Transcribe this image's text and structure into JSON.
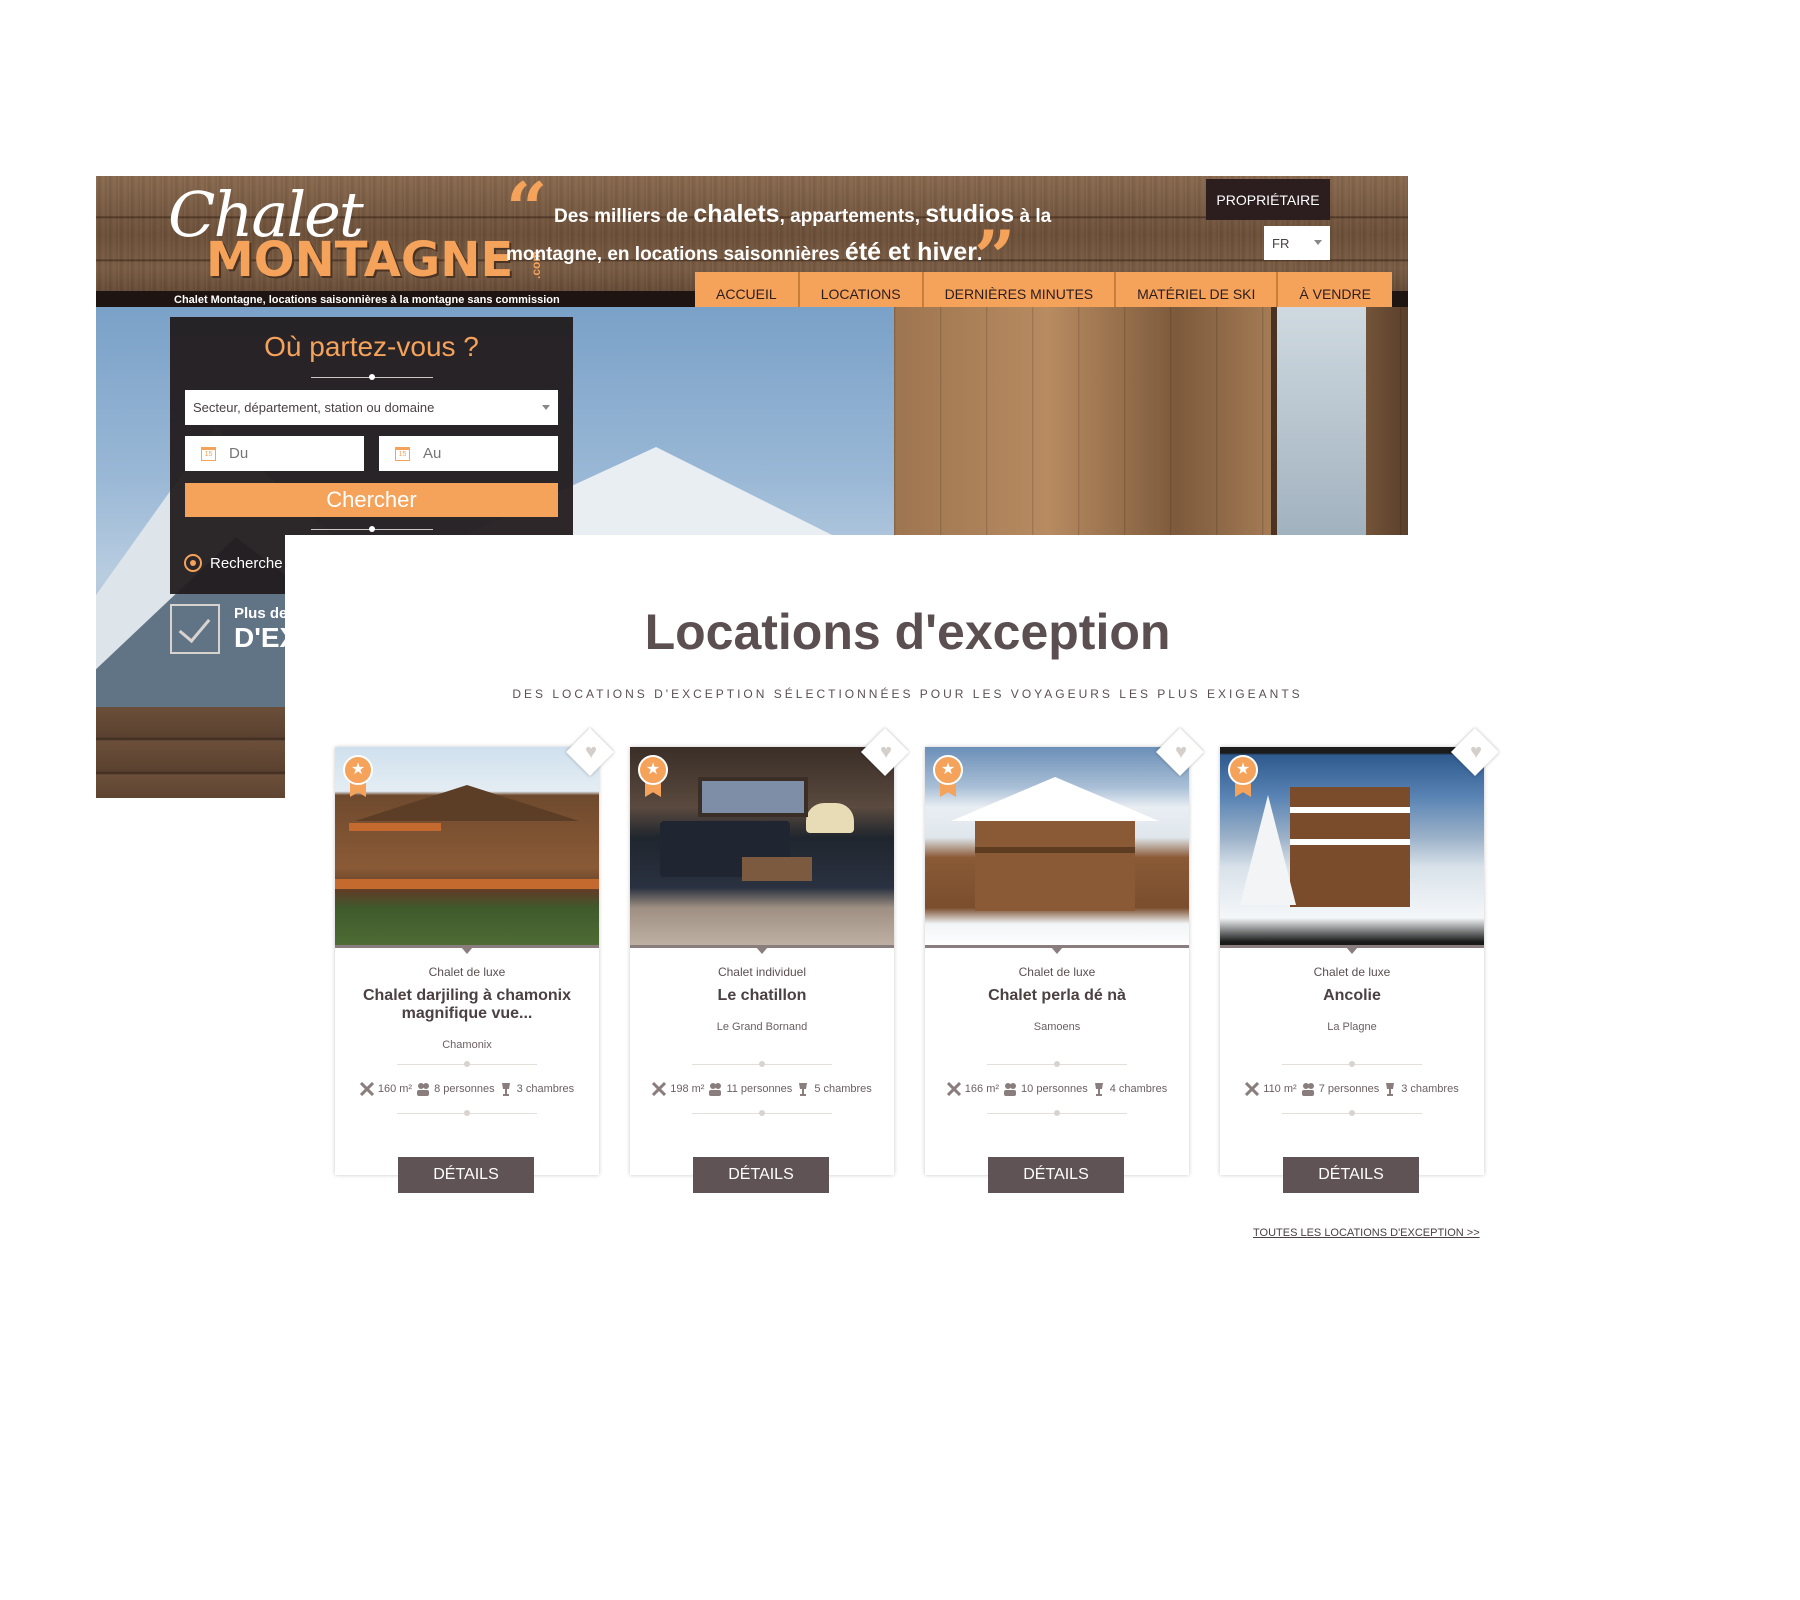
{
  "header": {
    "logo_script": "Chalet",
    "logo_main": "MONTAGNE",
    "logo_suffix": ".com",
    "tagline": "Chalet Montagne, locations saisonnières à la montagne sans commission",
    "quote": {
      "l1_a": "Des milliers de ",
      "l1_b": "chalets",
      "l1_c": ", appartements, ",
      "l1_d": "studios",
      "l1_e": " à la",
      "l2_a": "montagne, en locations saisonnières ",
      "l2_b": "été et hiver",
      "l2_c": "."
    },
    "owner_button": "PROPRIÉTAIRE",
    "language": "FR",
    "nav": [
      "ACCUEIL",
      "LOCATIONS",
      "DERNIÈRES MINUTES",
      "MATÉRIEL DE SKI",
      "À VENDRE"
    ]
  },
  "search": {
    "title": "Où partez-vous ?",
    "sector_placeholder": "Secteur, département, station ou domaine",
    "from_placeholder": "Du",
    "to_placeholder": "Au",
    "calendar_day": "15",
    "button": "Chercher",
    "advanced": "Recherche",
    "promo_line1": "Plus de",
    "promo_line2": "D'EX"
  },
  "exception": {
    "title": "Locations d'exception",
    "subtitle": "DES LOCATIONS D'EXCEPTION SÉLECTIONNÉES POUR LES VOYAGEURS LES PLUS EXIGEANTS",
    "cards": [
      {
        "type": "Chalet de luxe",
        "name": "Chalet darjiling à chamonix magnifique vue...",
        "location": "Chamonix",
        "area": "160 m²",
        "persons": "8 personnes",
        "rooms": "3 chambres",
        "button": "DÉTAILS"
      },
      {
        "type": "Chalet individuel",
        "name": "Le chatillon",
        "location": "Le Grand Bornand",
        "area": "198 m²",
        "persons": "11 personnes",
        "rooms": "5 chambres",
        "button": "DÉTAILS"
      },
      {
        "type": "Chalet de luxe",
        "name": "Chalet perla dé nà",
        "location": "Samoens",
        "area": "166 m²",
        "persons": "10 personnes",
        "rooms": "4 chambres",
        "button": "DÉTAILS"
      },
      {
        "type": "Chalet de luxe",
        "name": "Ancolie",
        "location": "La Plagne",
        "area": "110 m²",
        "persons": "7 personnes",
        "rooms": "3 chambres",
        "button": "DÉTAILS"
      }
    ],
    "all_link": "TOUTES LES LOCATIONS D'EXCEPTION >>"
  },
  "colors": {
    "accent": "#f5a25b",
    "dark": "#2c1d1e",
    "button_details": "#5f5355",
    "text": "#4b4042"
  },
  "icons": [
    "star-badge-icon",
    "heart-icon",
    "area-icon",
    "persons-icon",
    "bedroom-icon",
    "calendar-icon",
    "target-icon",
    "check-icon",
    "dropdown-arrow-icon"
  ]
}
